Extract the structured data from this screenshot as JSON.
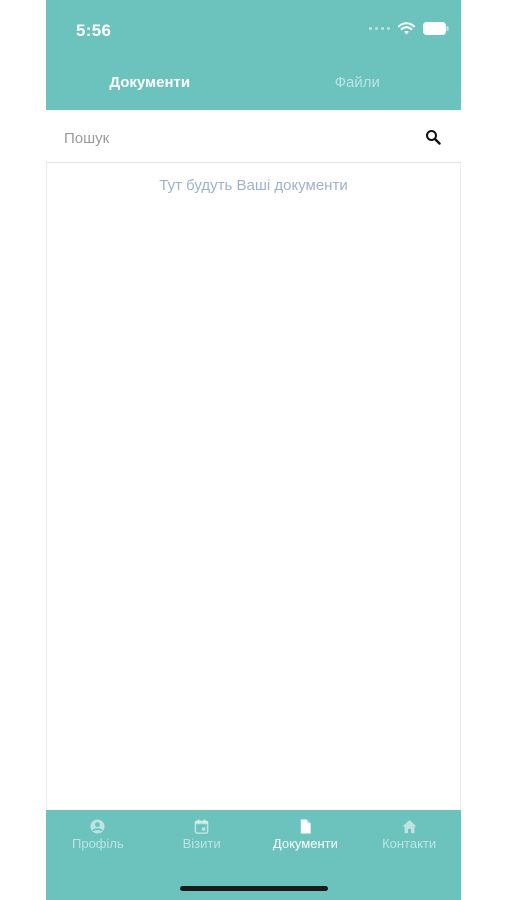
{
  "status_bar": {
    "time": "5:56"
  },
  "tabs": [
    {
      "label": "Документи",
      "active": true
    },
    {
      "label": "Файли",
      "active": false
    }
  ],
  "search": {
    "placeholder": "Пошук",
    "value": "",
    "icon": "search-icon"
  },
  "main": {
    "empty_message": "Тут будуть Ваші документи"
  },
  "bottom_nav": {
    "items": [
      {
        "label": "Профіль",
        "icon": "profile-icon",
        "active": false
      },
      {
        "label": "Візити",
        "icon": "calendar-icon",
        "active": false
      },
      {
        "label": "Документи",
        "icon": "document-icon",
        "active": true
      },
      {
        "label": "Контакти",
        "icon": "home-icon",
        "active": false
      }
    ]
  },
  "colors": {
    "accent": "#6cc3be",
    "empty_text": "#9fb2cc"
  }
}
